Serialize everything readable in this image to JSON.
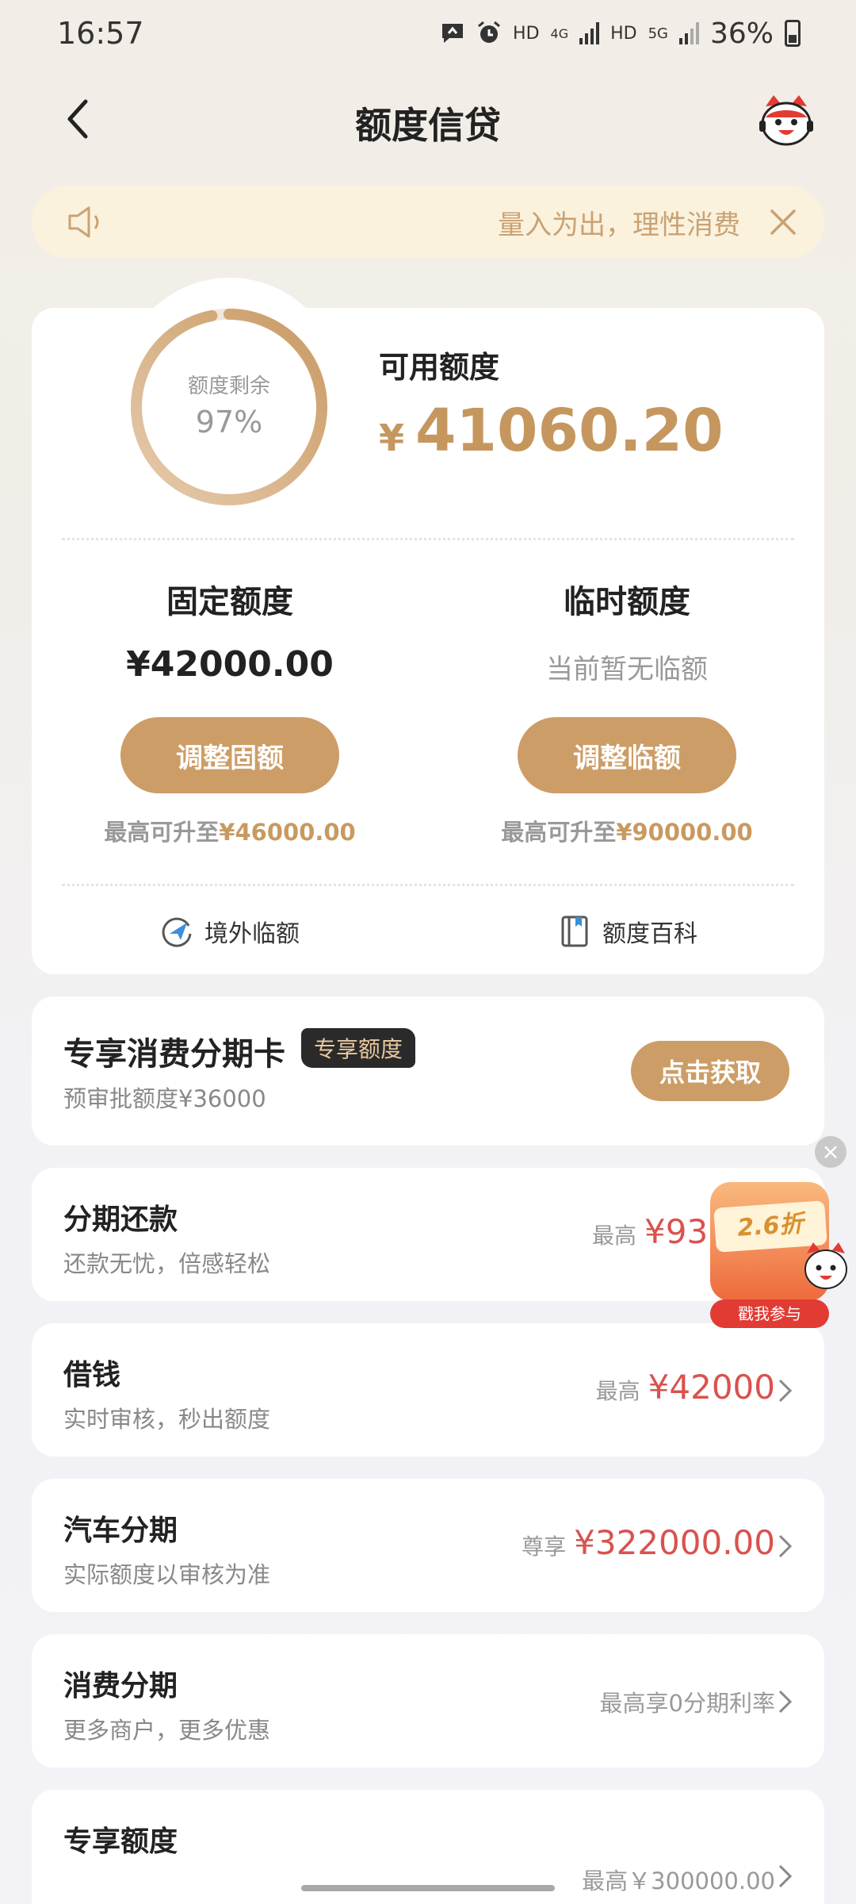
{
  "status_bar": {
    "time": "16:57",
    "hd1": "HD",
    "net1": "4G",
    "hd2": "HD",
    "net2": "5G",
    "battery": "36%"
  },
  "header": {
    "title": "额度信贷"
  },
  "notice": {
    "text": "量入为出，理性消费"
  },
  "credit": {
    "ring_label": "额度剩余",
    "ring_percent": "97%",
    "ring_fraction": 0.97,
    "available_label": "可用额度",
    "currency": "¥",
    "available_amount": "41060.20",
    "fixed": {
      "title": "固定额度",
      "amount": "¥42000.00",
      "button": "调整固额",
      "max_prefix": "最高可升至",
      "max_value": "¥46000.00"
    },
    "temporary": {
      "title": "临时额度",
      "status": "当前暂无临额",
      "button": "调整临额",
      "max_prefix": "最高可升至",
      "max_value": "¥90000.00"
    },
    "links": {
      "overseas": "境外临额",
      "wiki": "额度百科"
    }
  },
  "installment_card": {
    "title": "专享消费分期卡",
    "tag": "专享额度",
    "subtitle": "预审批额度¥36000",
    "button": "点击获取"
  },
  "services": [
    {
      "title": "分期还款",
      "subtitle": "还款无忧，倍感轻松",
      "prefix": "最高",
      "value": "¥939.0"
    },
    {
      "title": "借钱",
      "subtitle": "实时审核，秒出额度",
      "prefix": "最高",
      "value": "¥42000"
    },
    {
      "title": "汽车分期",
      "subtitle": "实际额度以审核为准",
      "prefix": "尊享",
      "value": "¥322000.00"
    },
    {
      "title": "消费分期",
      "subtitle": "更多商户，更多优惠",
      "plain": "最高享0分期利率"
    },
    {
      "title": "专享额度",
      "plain": "最高￥300000.00"
    }
  ],
  "promo": {
    "rate": "2.6折",
    "cta": "戳我参与"
  },
  "colors": {
    "gold": "#cc9d66",
    "red": "#d9524e",
    "notice_bg": "#fbf2dd"
  }
}
